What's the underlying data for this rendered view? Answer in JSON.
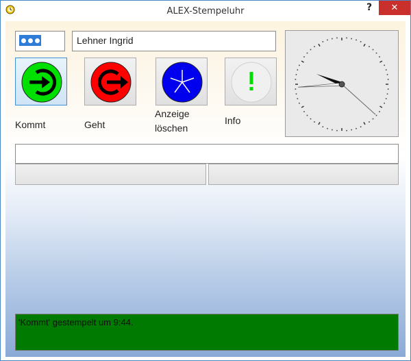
{
  "window": {
    "title": "ALEX-Stempeluhr",
    "help_label": "?",
    "close_label": "✕"
  },
  "header": {
    "name_value": "Lehner Ingrid"
  },
  "actions": {
    "kommt_label": "Kommt",
    "geht_label": "Geht",
    "clear_label_line1": "Anzeige",
    "clear_label_line2": "löschen",
    "info_label": "Info"
  },
  "clock": {
    "hour": 9,
    "minute": 44,
    "second": 22
  },
  "status": {
    "message": "'Kommt' gestempelt um  9:44."
  },
  "colors": {
    "kommt": "#00e000",
    "geht": "#ff0000",
    "clear": "#0000ee",
    "info_mark": "#00dd00",
    "message_bg": "#007a00"
  }
}
